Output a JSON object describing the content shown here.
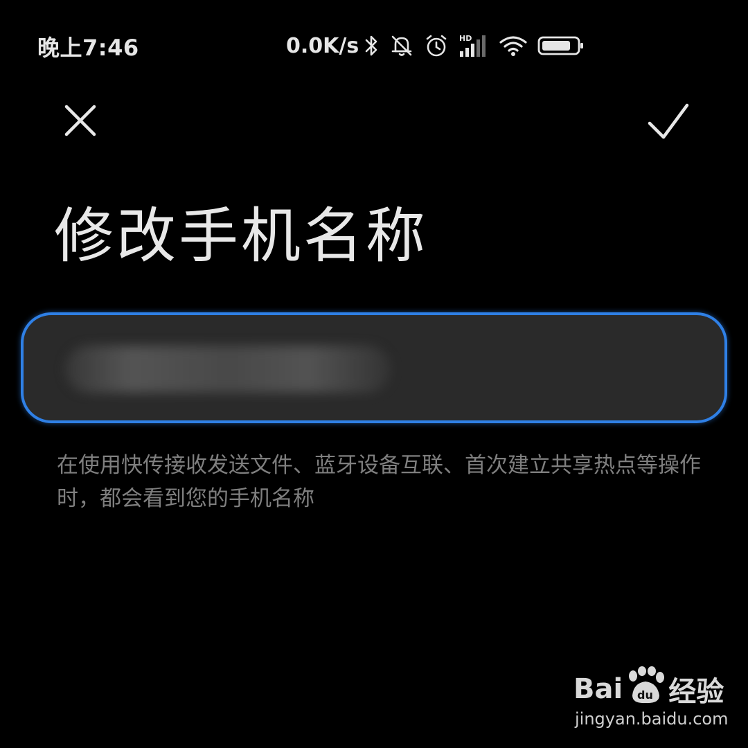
{
  "status_bar": {
    "time": "晚上7:46",
    "net_speed": "0.0K/s",
    "icons": [
      "bluetooth-icon",
      "mute-bell-icon",
      "alarm-icon",
      "hd-signal-icon",
      "wifi-icon",
      "battery-icon"
    ],
    "hd_label": "HD"
  },
  "toolbar": {
    "close_icon": "close-icon",
    "confirm_icon": "check-icon"
  },
  "page": {
    "title": "修改手机名称"
  },
  "name_input": {
    "value": "",
    "value_obscured": true
  },
  "hint": {
    "text": "在使用快传接收发送文件、蓝牙设备互联、首次建立共享热点等操作时，都会看到您的手机名称"
  },
  "watermark": {
    "brand_left": "Bai",
    "brand_right": "经验",
    "paw_label": "du",
    "url": "jingyan.baidu.com"
  },
  "colors": {
    "background": "#000000",
    "accent": "#2f80e6",
    "input_bg": "#2a2a2a",
    "hint": "#7f7f7f"
  }
}
